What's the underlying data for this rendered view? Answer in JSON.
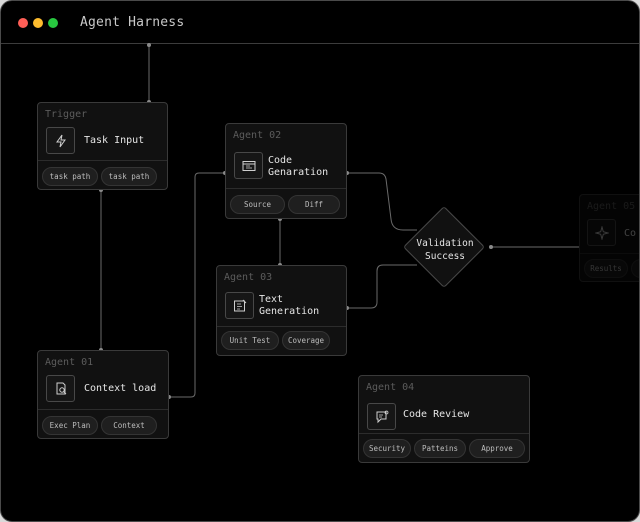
{
  "window": {
    "title": "Agent Harness",
    "traffic_lights": [
      "#ff5f57",
      "#febc2e",
      "#28c840"
    ]
  },
  "nodes": {
    "trigger": {
      "head": "Trigger",
      "name": "Task Input",
      "icon": "lightning-icon",
      "tags": [
        "task path",
        "task path"
      ]
    },
    "agent01": {
      "head": "Agent 01",
      "name": "Context load",
      "icon": "document-search-icon",
      "tags": [
        "Exec Plan",
        "Context"
      ]
    },
    "agent02": {
      "head": "Agent 02",
      "name": "Code\nGenaration",
      "icon": "code-window-icon",
      "tags": [
        "Source",
        "Diff"
      ]
    },
    "agent03": {
      "head": "Agent 03",
      "name": "Text\nGeneration",
      "icon": "text-edit-icon",
      "tags": [
        "Unit Test",
        "Coverage"
      ]
    },
    "agent04": {
      "head": "Agent 04",
      "name": "Code Review",
      "icon": "review-chat-icon",
      "tags": [
        "Security",
        "Patteins",
        "Approve"
      ]
    },
    "agent05": {
      "head": "Agent 05",
      "name": "Co",
      "icon": "sparkle-icon",
      "tags": [
        "Results",
        "R"
      ]
    }
  },
  "decision": {
    "label": "Validation\nSuccess"
  },
  "colors": {
    "background": "#000000",
    "node_fill": "#111111",
    "node_border": "#3a3a3a",
    "edge": "#6a6a6a"
  }
}
